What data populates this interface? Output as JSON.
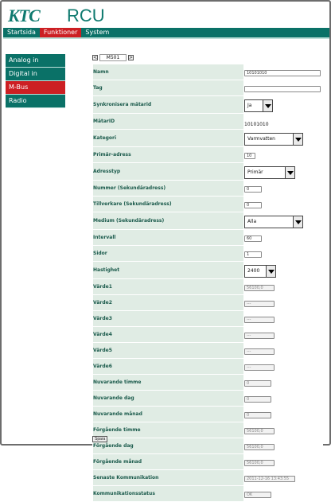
{
  "header": {
    "logo": "KTC",
    "title": "RCU"
  },
  "topnav": [
    {
      "label": "Startsida",
      "active": false
    },
    {
      "label": "Funktioner",
      "active": true
    },
    {
      "label": "System",
      "active": false
    }
  ],
  "sidebar": [
    {
      "label": "Analog in",
      "active": false
    },
    {
      "label": "Digital in",
      "active": false
    },
    {
      "label": "M-Bus",
      "active": true
    },
    {
      "label": "Radio",
      "active": false
    }
  ],
  "pager": {
    "prev": "<",
    "current": "M501",
    "next": ">"
  },
  "fields": [
    {
      "label": "Namn",
      "kind": "input",
      "value": "10101010",
      "w": 96
    },
    {
      "label": "Tag",
      "kind": "input",
      "value": "",
      "w": 96
    },
    {
      "label": "Synkronisera mätarid",
      "kind": "select",
      "value": "Ja",
      "w": 36
    },
    {
      "label": "MätarID",
      "kind": "static",
      "value": "10101010"
    },
    {
      "label": "Kategori",
      "kind": "select",
      "value": "Varmvatten",
      "w": 74
    },
    {
      "label": "Primär-adress",
      "kind": "input",
      "value": "10",
      "w": 14
    },
    {
      "label": "Adresstyp",
      "kind": "select",
      "value": "Primär",
      "w": 64
    },
    {
      "label": "Nummer (Sekundäradress)",
      "kind": "input",
      "value": "0",
      "w": 22
    },
    {
      "label": "Tillverkare (Sekundäradress)",
      "kind": "input",
      "value": "0",
      "w": 22
    },
    {
      "label": "Medium (Sekundäradress)",
      "kind": "select",
      "value": "Alla",
      "w": 74
    },
    {
      "label": "Intervall",
      "kind": "input",
      "value": "60",
      "w": 22
    },
    {
      "label": "Sidor",
      "kind": "input",
      "value": "1",
      "w": 22
    },
    {
      "label": "Hastighet",
      "kind": "select",
      "value": "2400",
      "w": 40
    },
    {
      "label": "Värde1",
      "kind": "readonly",
      "value": "56100,0",
      "w": 38
    },
    {
      "label": "Värde2",
      "kind": "readonly",
      "value": "---",
      "w": 38
    },
    {
      "label": "Värde3",
      "kind": "readonly",
      "value": "---",
      "w": 38
    },
    {
      "label": "Värde4",
      "kind": "readonly",
      "value": "---",
      "w": 38
    },
    {
      "label": "Värde5",
      "kind": "readonly",
      "value": "---",
      "w": 38
    },
    {
      "label": "Värde6",
      "kind": "readonly",
      "value": "---",
      "w": 38
    },
    {
      "label": "Nuvarande timme",
      "kind": "readonly",
      "value": "0",
      "w": 34
    },
    {
      "label": "Nuvarande dag",
      "kind": "readonly",
      "value": "0",
      "w": 34
    },
    {
      "label": "Nuvarande månad",
      "kind": "readonly",
      "value": "0",
      "w": 34
    },
    {
      "label": "Förgående timme",
      "kind": "readonly",
      "value": "56100,0",
      "w": 38
    },
    {
      "label": "Förgående dag",
      "kind": "readonly",
      "value": "56100,0",
      "w": 38
    },
    {
      "label": "Förgående månad",
      "kind": "readonly",
      "value": "56100,0",
      "w": 38
    },
    {
      "label": "Senaste Kommunikation",
      "kind": "readonly",
      "value": "2011-12-16 13:43:55",
      "w": 64
    },
    {
      "label": "Kommunikationsstatus",
      "kind": "readonly",
      "value": "OK",
      "w": 34
    }
  ],
  "save_label": "Spara"
}
